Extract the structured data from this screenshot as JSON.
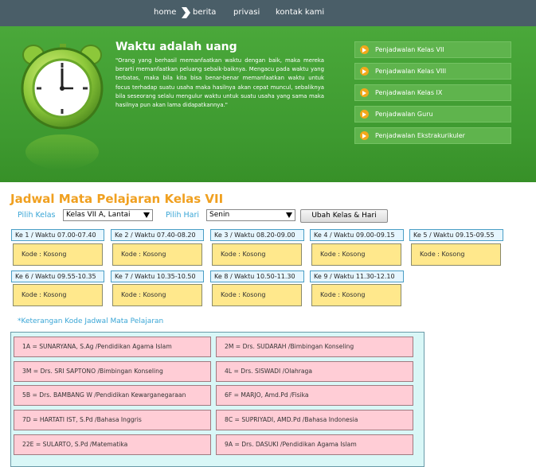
{
  "nav": {
    "home": "home",
    "berita": "berita",
    "privasi": "privasi",
    "kontak": "kontak kami"
  },
  "hero": {
    "title": "Waktu adalah uang",
    "quote": "\"Orang yang berhasil memanfaatkan waktu dengan baik, maka mereka berarti memanfaatkan peluang sebaik-baiknya. Mengacu pada waktu yang terbatas, maka bila kita bisa benar-benar memanfaatkan waktu untuk focus terhadap suatu usaha maka hasilnya akan cepat muncul, sebaliknya bila seseorang selalu mengulur waktu untuk suatu usaha yang sama maka hasilnya pun akan lama didapatkannya.\""
  },
  "side_menu": [
    "Penjadwalan Kelas VII",
    "Penjadwalan Kelas VIII",
    "Penjadwalan Kelas IX",
    "Penjadwalan Guru",
    "Penjadwalan Ekstrakurikuler"
  ],
  "main": {
    "title": "Jadwal Mata Pelajaran Kelas VII",
    "pilih_kelas_label": "Pilih Kelas",
    "pilih_kelas_value": "Kelas VII A, Lantai",
    "pilih_hari_label": "Pilih Hari",
    "pilih_hari_value": "Senin",
    "submit_label": "Ubah Kelas & Hari"
  },
  "slots": [
    {
      "header": "Ke 1 / Waktu 07.00-07.40",
      "code": "Kode : Kosong"
    },
    {
      "header": "Ke 2 / Waktu 07.40-08.20",
      "code": "Kode : Kosong"
    },
    {
      "header": "Ke 3 / Waktu 08.20-09.00",
      "code": "Kode : Kosong"
    },
    {
      "header": "Ke 4 / Waktu 09.00-09.15",
      "code": "Kode : Kosong"
    },
    {
      "header": "Ke 5 / Waktu 09.15-09.55",
      "code": "Kode : Kosong"
    },
    {
      "header": "Ke 6 / Waktu 09.55-10.35",
      "code": "Kode : Kosong"
    },
    {
      "header": "Ke 7 / Waktu 10.35-10.50",
      "code": "Kode : Kosong"
    },
    {
      "header": "Ke 8 / Waktu 10.50-11.30",
      "code": "Kode : Kosong"
    },
    {
      "header": "Ke 9 / Waktu 11.30-12.10",
      "code": "Kode : Kosong"
    }
  ],
  "legend": {
    "note": "*Keterangan Kode Jadwal Mata Pelajaran",
    "items": [
      "1A = SUNARYANA, S.Ag /Pendidikan Agama Islam",
      "2M = Drs. SUDARAH /Bimbingan Konseling",
      "3M = Drs. SRI SAPTONO /Bimbingan Konseling",
      "4L = Drs. SISWADI /Olahraga",
      "5B = Drs. BAMBANG W /Pendidikan Kewarganegaraan",
      "6F = MARJO, Amd.Pd /Fisika",
      "7D = HARTATI IST, S.Pd /Bahasa Inggris",
      "8C = SUPRIYADI, AMD.Pd /Bahasa Indonesia",
      "22E = SULARTO, S.Pd /Matematika",
      "9A = Drs. DASUKI /Pendidikan Agama Islam"
    ]
  }
}
